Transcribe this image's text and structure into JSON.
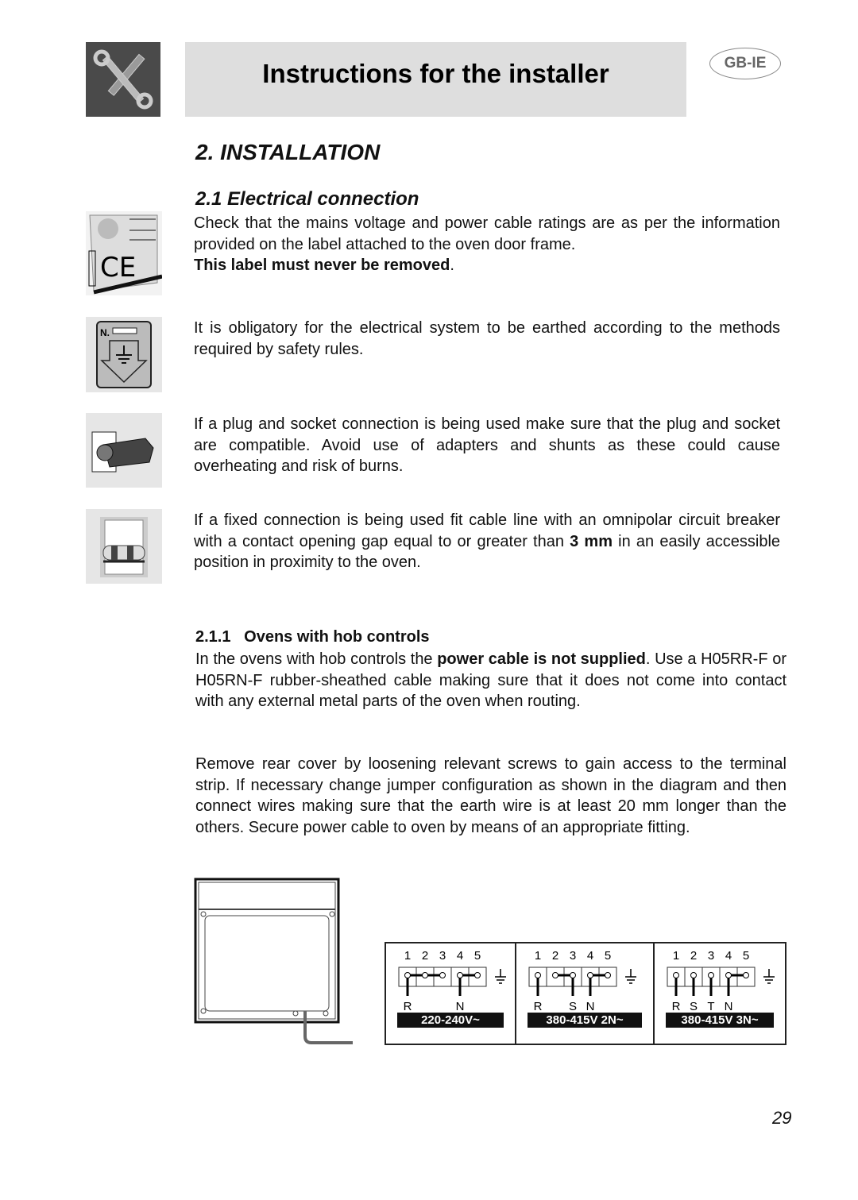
{
  "header": {
    "title": "Instructions for the installer",
    "lang_badge": "GB-IE",
    "tool_icon": "wrench-screwdriver-icon"
  },
  "section": {
    "title": "2.  INSTALLATION",
    "subsection": "2.1 Electrical connection",
    "p1": "Check that the mains voltage and power cable ratings are as per the information provided on the label attached to the oven door frame.",
    "p1_bold": "This label must never be removed",
    "p1_end": ".",
    "p2": "It is obligatory for the electrical system to be earthed according to the methods required by safety rules.",
    "p3": "If a plug and socket connection is being used make sure that the plug and socket are compatible. Avoid use of adapters and shunts as these could cause overheating and risk of burns.",
    "p4_a": "If a fixed connection is being used fit cable line with an omnipolar circuit breaker with a contact opening gap equal to or greater than ",
    "p4_bold": "3 mm",
    "p4_b": " in an easily accessible position in proximity to the oven.",
    "icons": [
      "ce-label-icon",
      "earth-plate-icon",
      "plug-socket-icon",
      "circuit-breaker-icon"
    ]
  },
  "subsubsection": {
    "title": "2.1.1   Ovens with hob controls",
    "p1_a": "In the ovens with hob controls the ",
    "p1_bold": "power cable is not supplied",
    "p1_b": ". Use a H05RR-F or H05RN-F rubber-sheathed cable making sure that it does not come into contact with any external metal parts of the oven when routing.",
    "p2": "Remove rear cover by loosening relevant screws to gain access to the terminal strip. If necessary change jumper configuration as shown in the diagram and then connect wires making sure that the earth wire is at least 20 mm longer than the others. Secure power cable to oven by means of  an appropriate fitting."
  },
  "wiring": [
    {
      "numbers": [
        "1",
        "2",
        "3",
        "4",
        "5"
      ],
      "wires": [
        "R",
        "",
        "",
        "N",
        ""
      ],
      "voltage": "220-240V~"
    },
    {
      "numbers": [
        "1",
        "2",
        "3",
        "4",
        "5"
      ],
      "wires": [
        "R",
        "",
        "S",
        "N",
        ""
      ],
      "voltage": "380-415V 2N~"
    },
    {
      "numbers": [
        "1",
        "2",
        "3",
        "4",
        "5"
      ],
      "wires": [
        "R",
        "S",
        "T",
        "N",
        ""
      ],
      "voltage": "380-415V 3N~"
    }
  ],
  "page_number": "29"
}
